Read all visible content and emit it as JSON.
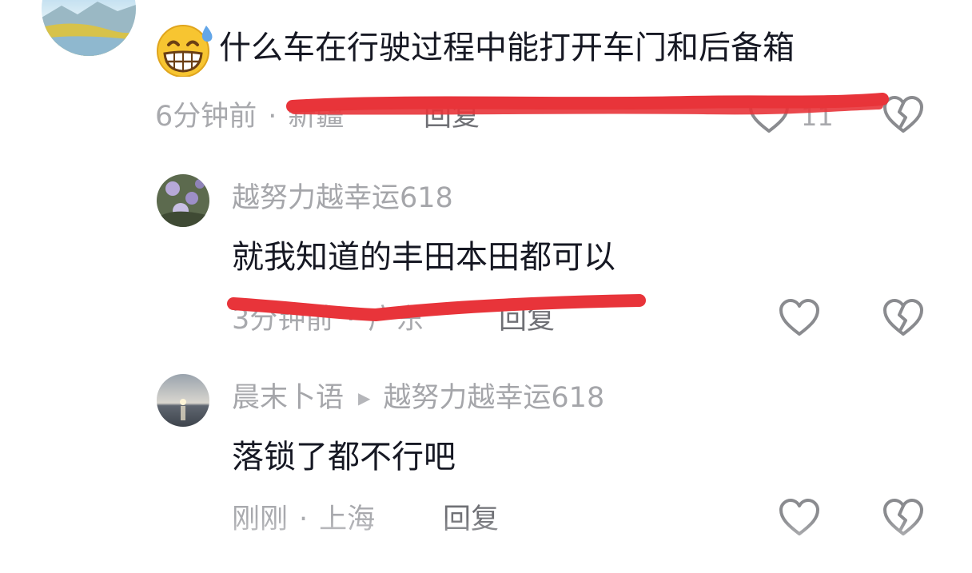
{
  "comment": {
    "text": "什么车在行驶过程中能打开车门和后备箱",
    "emoji": "grinning-sweat-emoji",
    "time": "6分钟前",
    "separator": "·",
    "location": "新疆",
    "reply_label": "回复",
    "like_count": "11"
  },
  "replies": [
    {
      "username": "越努力越幸运618",
      "text": "就我知道的丰田本田都可以",
      "time": "3分钟前",
      "separator": "·",
      "location": "广东",
      "reply_label": "回复"
    },
    {
      "username": "晨末卜语",
      "reply_to_arrow": "▶",
      "reply_to": "越努力越幸运618",
      "text": "落锁了都不行吧",
      "time": "刚刚",
      "separator": "·",
      "location": "上海",
      "reply_label": "回复"
    }
  ],
  "colors": {
    "primary_text": "#161823",
    "secondary_text": "#a8a9ad",
    "scribble_red": "#e8343a",
    "icon_gray": "#8a8b8f"
  }
}
